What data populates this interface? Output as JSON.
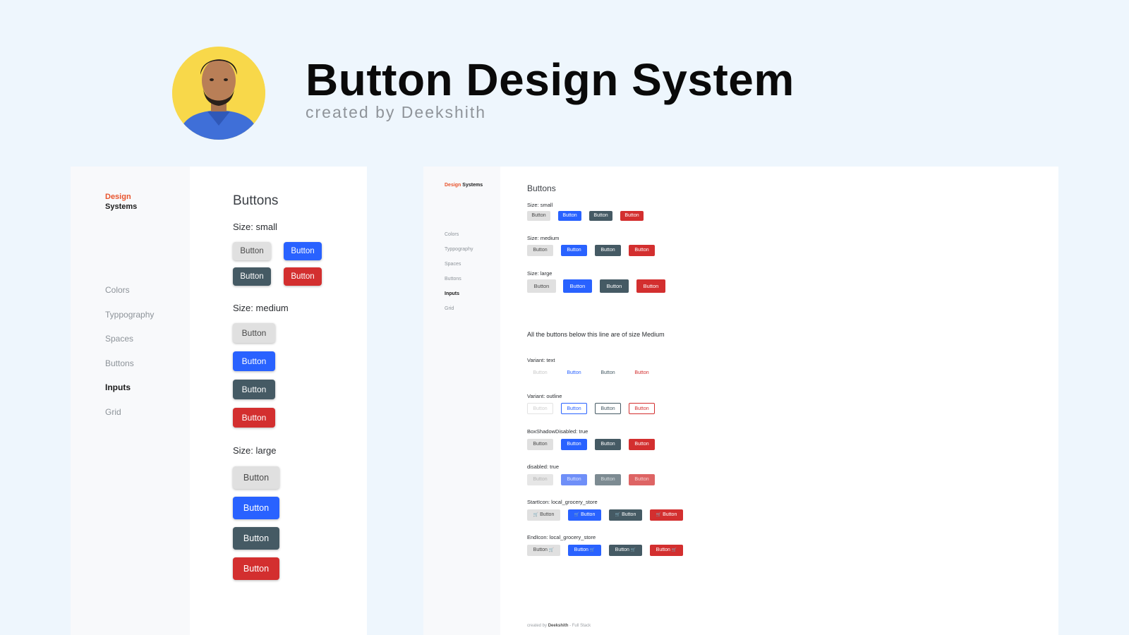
{
  "header": {
    "title": "Button Design System",
    "subtitle": "created by Deekshith"
  },
  "brand": {
    "line1": "Design",
    "line2": "Systems"
  },
  "nav": [
    "Colors",
    "Typpography",
    "Spaces",
    "Buttons",
    "Inputs",
    "Grid"
  ],
  "nav_active": "Inputs",
  "left": {
    "title": "Buttons",
    "size_small": "Size: small",
    "size_medium": "Size: medium",
    "size_large": "Size: large"
  },
  "right": {
    "title": "Buttons",
    "size_small": "Size: small",
    "size_medium": "Size: medium",
    "size_large": "Size: large",
    "note": "All the buttons below this line are of size Medium",
    "variant_text": "Variant: text",
    "variant_outline": "Variant: outline",
    "box_shadow_disabled": "BoxShadowDisabled: true",
    "disabled": "disabled: true",
    "start_icon": "StartIcon: local_grocery_store",
    "end_icon": "EndIcon: local_grocery_store"
  },
  "button_label": "Button",
  "cart_icon": "local-grocery-store-icon",
  "cart_glyph": "🛒",
  "colors": {
    "default": "#e0e0e0",
    "primary": "#2962ff",
    "secondary": "#455a64",
    "danger": "#d32f2f",
    "brand_accent": "#e8542d",
    "background": "#eef6fd"
  },
  "footer": {
    "prefix": "created by",
    "name": "Deekshith",
    "suffix": "- Full Stack"
  }
}
